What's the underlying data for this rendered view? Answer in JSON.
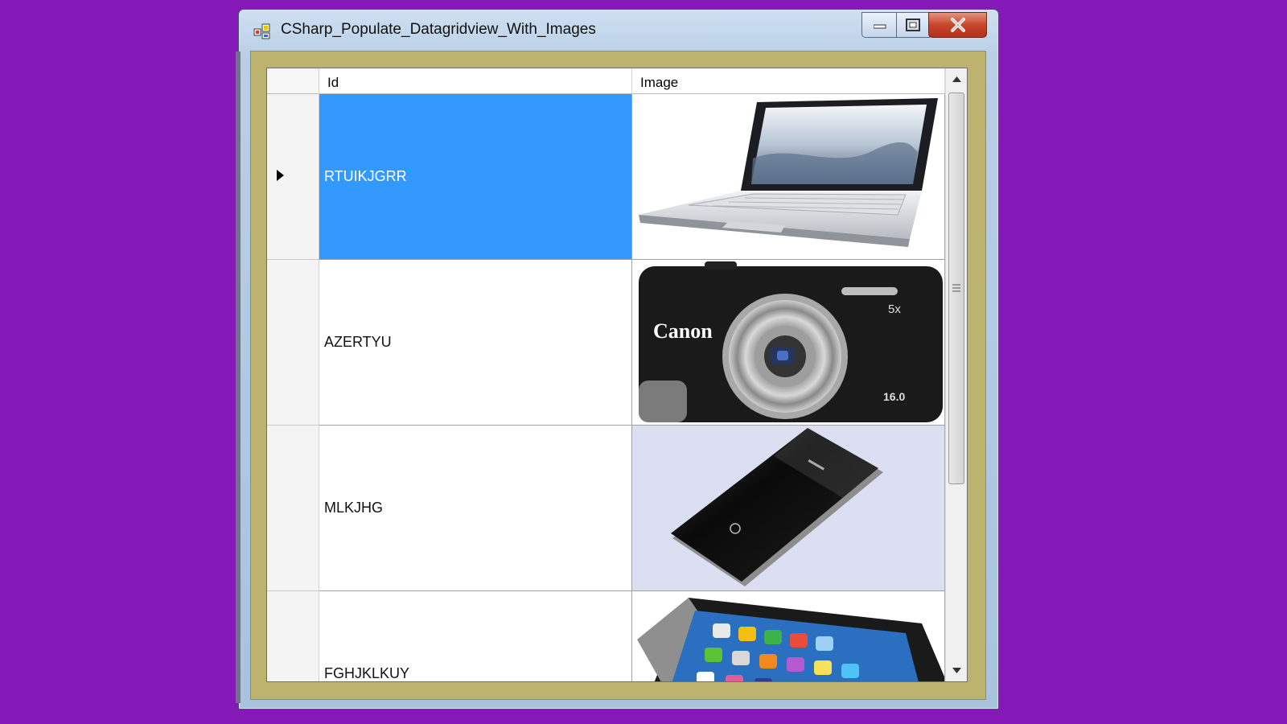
{
  "window": {
    "title": "CSharp_Populate_Datagridview_With_Images",
    "controls": {
      "minimize": "minimize-icon",
      "maximize": "maximize-icon",
      "close": "close-icon"
    }
  },
  "grid": {
    "columns": [
      "Id",
      "Image"
    ],
    "rows": [
      {
        "id": "RTUIKJGRR",
        "image": "laptop",
        "selected": true
      },
      {
        "id": "AZERTYU",
        "image": "canon-camera",
        "selected": false
      },
      {
        "id": "MLKJHG",
        "image": "huawei-mobile-wifi",
        "selected": false
      },
      {
        "id": "FGHJKLKUY",
        "image": "iphone",
        "selected": false
      }
    ]
  },
  "image_text": {
    "camera_brand": "Canon",
    "camera_zoom": "5x",
    "camera_mp": "16.0"
  },
  "colors": {
    "background": "#8419b8",
    "selection": "#3399ff",
    "client_area": "#bcb46e"
  }
}
